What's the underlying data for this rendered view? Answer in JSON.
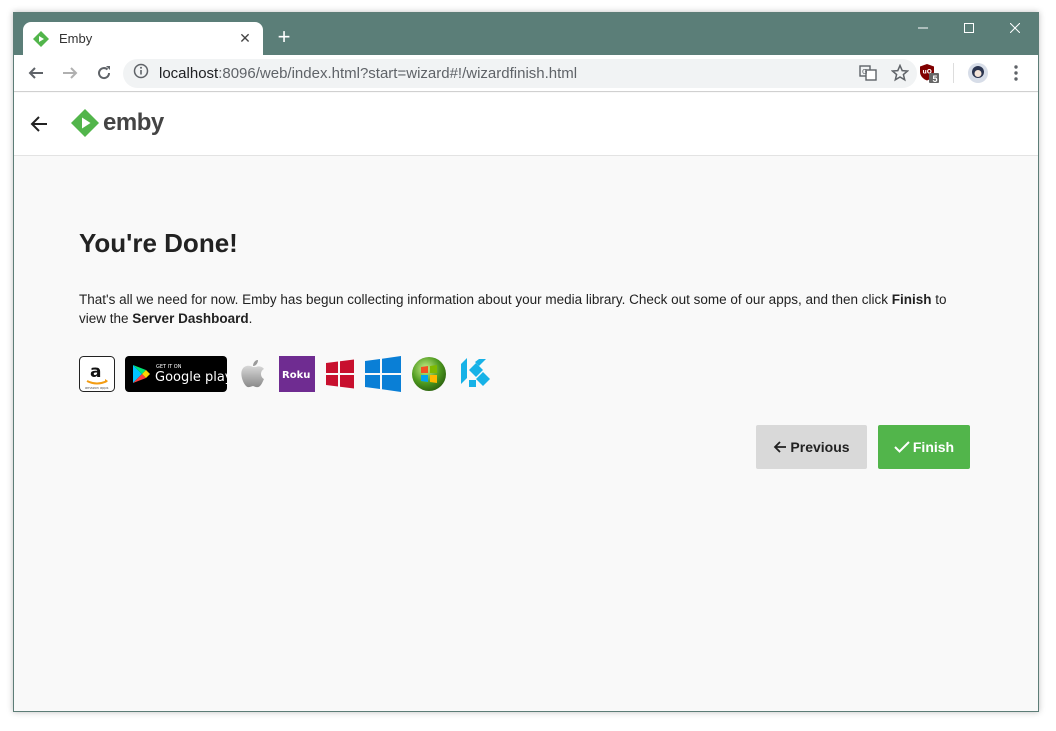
{
  "browser": {
    "tab_title": "Emby",
    "url_host": "localhost",
    "url_rest": ":8096/web/index.html?start=wizard#!/wizardfinish.html",
    "extension_badge": "5"
  },
  "app": {
    "logo_text": "emby"
  },
  "page": {
    "heading": "You're Done!",
    "desc_part1": "That's all we need for now. Emby has begun collecting information about your media library. Check out some of our apps, and then click ",
    "desc_finish": "Finish",
    "desc_part2": " to view the ",
    "desc_dashboard": "Server Dashboard",
    "desc_end": "."
  },
  "apps": {
    "google_play_top": "GET IT ON",
    "google_play_label": "Google play",
    "roku_label": "Roku"
  },
  "buttons": {
    "previous": "Previous",
    "finish": "Finish"
  },
  "colors": {
    "brand_green": "#52b54b",
    "titlebar": "#5b7e78"
  }
}
